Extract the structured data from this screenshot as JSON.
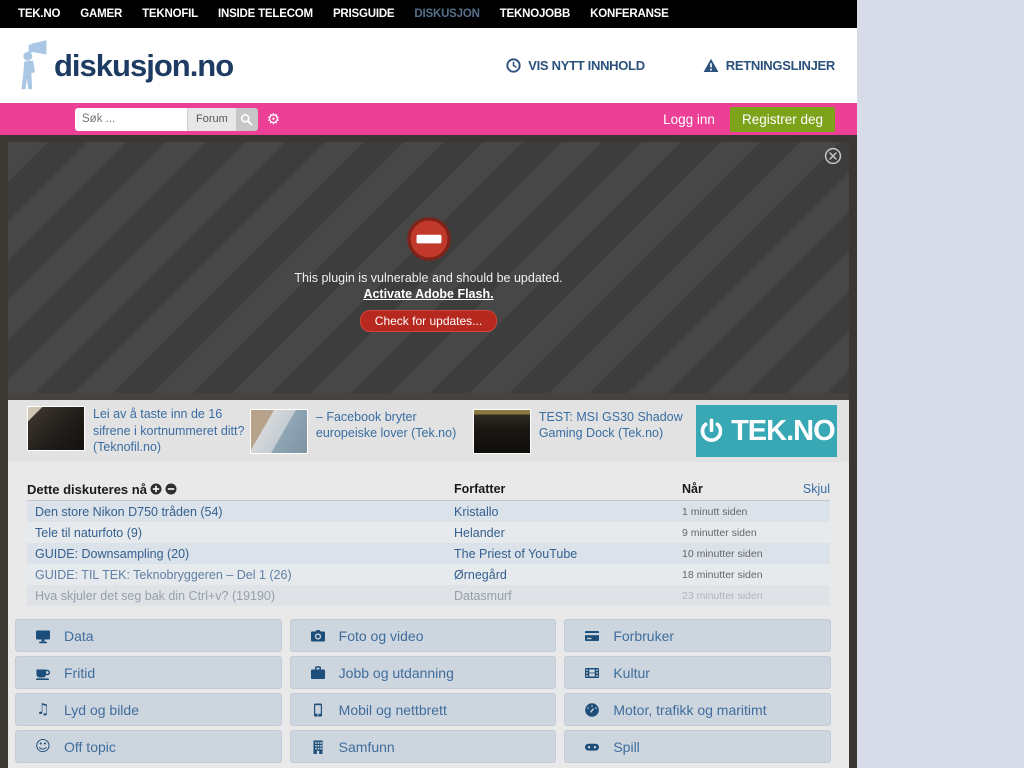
{
  "topnav": {
    "items": [
      {
        "label": "TEK.NO"
      },
      {
        "label": "GAMER"
      },
      {
        "label": "TEKNOFIL"
      },
      {
        "label": "INSIDE TELECOM"
      },
      {
        "label": "PRISGUIDE"
      },
      {
        "label": "DISKUSJON",
        "active": true
      },
      {
        "label": "TEKNOJOBB"
      },
      {
        "label": "KONFERANSE"
      }
    ]
  },
  "header": {
    "logo_text": "diskusjon.no",
    "new_content_label": "VIS NYTT INNHOLD",
    "guidelines_label": "RETNINGSLINJER"
  },
  "searchbar": {
    "placeholder": "Søk ...",
    "scope_label": "Forum",
    "login_label": "Logg inn",
    "register_label": "Registrer deg"
  },
  "plugin": {
    "message": "This plugin is vulnerable and should be updated.",
    "activate_label": "Activate Adobe Flash.",
    "update_label": "Check for updates..."
  },
  "news": {
    "brand_label": "TEK.NO",
    "items": [
      {
        "title": "Lei av å taste inn de 16 sifrene i kortnummeret ditt? (Teknofil.no)"
      },
      {
        "title": "– Facebook bryter europeiske lover (Tek.no)"
      },
      {
        "title": "TEST: MSI GS30 Shadow Gaming Dock (Tek.no)"
      }
    ]
  },
  "topics": {
    "title": "Dette diskuteres nå",
    "col_author": "Forfatter",
    "col_when": "Når",
    "hide_label": "Skjul",
    "rows": [
      {
        "title": "Den store Nikon D750 tråden (54)",
        "author": "Kristallo",
        "when": "1 minutt siden"
      },
      {
        "title": "Tele til naturfoto (9)",
        "author": "Helander",
        "when": "9 minutter siden"
      },
      {
        "title": "GUIDE: Downsampling (20)",
        "author": "The Priest of YouTube",
        "when": "10 minutter siden"
      },
      {
        "title": "GUIDE: TIL TEK: Teknobryggeren – Del 1 (26)",
        "author": "Ørnegård",
        "when": "18 minutter siden"
      },
      {
        "title": "Hva skjuler det seg bak din Ctrl+v? (19190)",
        "author": "Datasmurf",
        "when": "23 minutter siden"
      }
    ]
  },
  "categories": [
    {
      "label": "Data",
      "icon": "monitor-icon"
    },
    {
      "label": "Foto og video",
      "icon": "camera-icon"
    },
    {
      "label": "Forbruker",
      "icon": "credit-card-icon"
    },
    {
      "label": "Fritid",
      "icon": "coffee-icon"
    },
    {
      "label": "Jobb og utdanning",
      "icon": "briefcase-icon"
    },
    {
      "label": "Kultur",
      "icon": "film-icon"
    },
    {
      "label": "Lyd og bilde",
      "icon": "music-icon"
    },
    {
      "label": "Mobil og nettbrett",
      "icon": "mobile-icon"
    },
    {
      "label": "Motor, trafikk og maritimt",
      "icon": "gauge-icon"
    },
    {
      "label": "Off topic",
      "icon": "smiley-icon"
    },
    {
      "label": "Samfunn",
      "icon": "building-icon"
    },
    {
      "label": "Spill",
      "icon": "gamepad-icon"
    }
  ],
  "colors": {
    "accent_pink": "#ec3f96",
    "register_green": "#7da31b",
    "brand_teal": "#38a8b5",
    "link_blue": "#3a6da3",
    "alert_red": "#b7281e",
    "nav_active": "#56708c"
  }
}
